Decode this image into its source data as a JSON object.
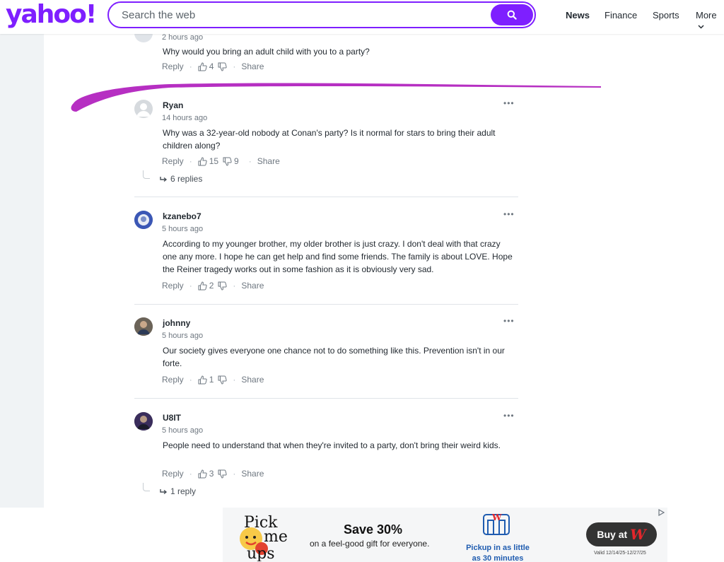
{
  "header": {
    "logo": "yahoo!",
    "search_placeholder": "Search the web",
    "nav": [
      "News",
      "Finance",
      "Sports",
      "More"
    ]
  },
  "comments": [
    {
      "time": "2 hours ago",
      "body": "Why would you bring an adult child with you to a party?",
      "likes": "4",
      "dislikes": "",
      "reply_label": "Reply",
      "share_label": "Share"
    },
    {
      "author": "Ryan",
      "time": "14 hours ago",
      "body": "Why was a 32-year-old nobody at Conan's party? Is it normal for stars to bring their adult children along?",
      "likes": "15",
      "dislikes": "9",
      "reply_label": "Reply",
      "share_label": "Share",
      "replies": "6 replies"
    },
    {
      "author": "kzanebo7",
      "time": "5 hours ago",
      "body": "According to my younger brother, my older brother is just crazy.  I don't deal with that crazy one any more.  I hope he can get help and find some friends.  The family is about LOVE.  Hope the Reiner tragedy works out in some fashion as it is obviously very sad.",
      "likes": "2",
      "dislikes": "",
      "reply_label": "Reply",
      "share_label": "Share"
    },
    {
      "author": "johnny",
      "time": "5 hours ago",
      "body": "Our society gives everyone one chance not to do something like this. Prevention isn't in our forte.",
      "likes": "1",
      "dislikes": "",
      "reply_label": "Reply",
      "share_label": "Share"
    },
    {
      "author": "U8IT",
      "time": "5 hours ago",
      "body": "People need to understand that when they're invited to a party, don't bring their weird kids.",
      "likes": "3",
      "dislikes": "",
      "reply_label": "Reply",
      "share_label": "Share",
      "replies": "1 reply"
    }
  ],
  "more_icon_label": "•••",
  "ad": {
    "brand_art": "Pick me ups",
    "title": "Save 30%",
    "subtitle": "on a feel-good gift for everyone.",
    "pickup": "Pickup in as little as 30 minutes",
    "button": "Buy at",
    "button_logo": "W",
    "valid": "Valid 12/14/25-12/27/25"
  },
  "colors": {
    "brand": "#7e1fff",
    "annotation_stroke": "#b62fc2",
    "gutter": "#f0f3f5"
  }
}
